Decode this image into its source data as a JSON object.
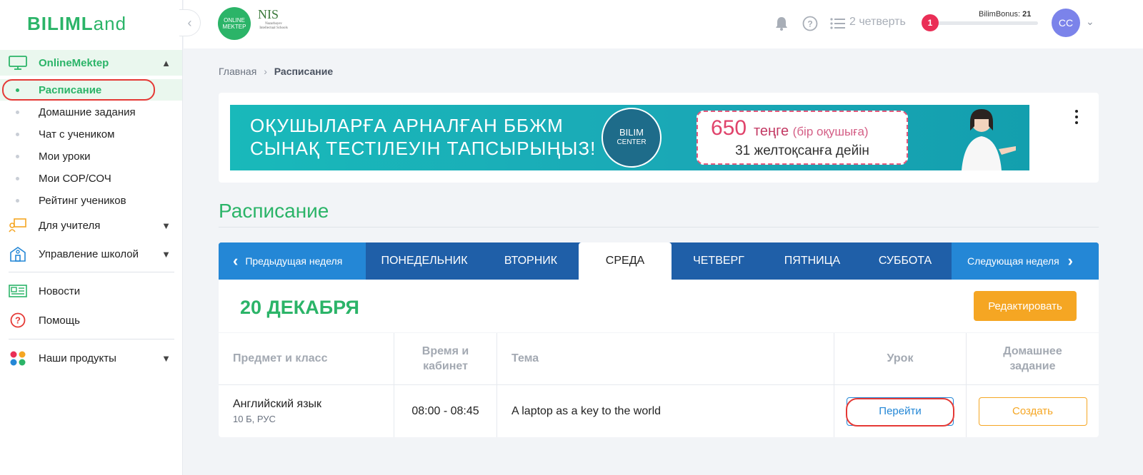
{
  "sidebar": {
    "logo": {
      "bold": "BILIML",
      "rest": "and"
    },
    "section": {
      "label": "OnlineMektep"
    },
    "subitems": [
      {
        "label": "Расписание"
      },
      {
        "label": "Домашние задания"
      },
      {
        "label": "Чат с учеником"
      },
      {
        "label": "Мои уроки"
      },
      {
        "label": "Мои СОР/СОЧ"
      },
      {
        "label": "Рейтинг учеников"
      }
    ],
    "nav": [
      {
        "label": "Для учителя",
        "icon": "teacher-icon"
      },
      {
        "label": "Управление школой",
        "icon": "school-icon"
      },
      {
        "label": "Новости",
        "icon": "news-icon"
      },
      {
        "label": "Помощь",
        "icon": "help-icon"
      },
      {
        "label": "Наши продукты",
        "icon": "products-icon"
      }
    ]
  },
  "header": {
    "om_logo": "ONLINE MEKTEP",
    "nis_logo": {
      "big": "NIS",
      "small": "Nazarbayev Intellectual Schools"
    },
    "quarter": "2 четверть",
    "bonus": {
      "badge": "1",
      "label": "BilimBonus:",
      "value": "21",
      "progress": 0.03
    },
    "avatar": "CC"
  },
  "breadcrumb": {
    "home": "Главная",
    "current": "Расписание"
  },
  "banner": {
    "line1": "ОҚУШЫЛАРҒА АРНАЛҒАН ББЖМ",
    "line2": "СЫНАҚ ТЕСТІЛЕУІН ТАПСЫРЫҢЫЗ!",
    "circle1": "BILIM",
    "circle2": "CENTER",
    "price": "650",
    "unit": "теңге",
    "unit_note": "(бір оқушыға)",
    "deadline": "31 желтоқсанға дейін"
  },
  "page_title": "Расписание",
  "tabs": {
    "prev": "Предыдущая неделя",
    "next": "Следующая неделя",
    "days": [
      "ПОНЕДЕЛЬНИК",
      "ВТОРНИК",
      "СРЕДА",
      "ЧЕТВЕРГ",
      "ПЯТНИЦА",
      "СУББОТА"
    ],
    "active_index": 2
  },
  "date_title": "20 ДЕКАБРЯ",
  "edit_button": "Редактировать",
  "table": {
    "headers": {
      "subject": "Предмет и класс",
      "time_line1": "Время и",
      "time_line2": "кабинет",
      "topic": "Тема",
      "lesson": "Урок",
      "hw_line1": "Домашнее",
      "hw_line2": "задание"
    },
    "rows": [
      {
        "subject": "Английский язык",
        "class": "10 Б, РУС",
        "time": "08:00 - 08:45",
        "topic": "A laptop as a key to the world",
        "lesson_button": "Перейти",
        "hw_button": "Создать"
      }
    ]
  }
}
